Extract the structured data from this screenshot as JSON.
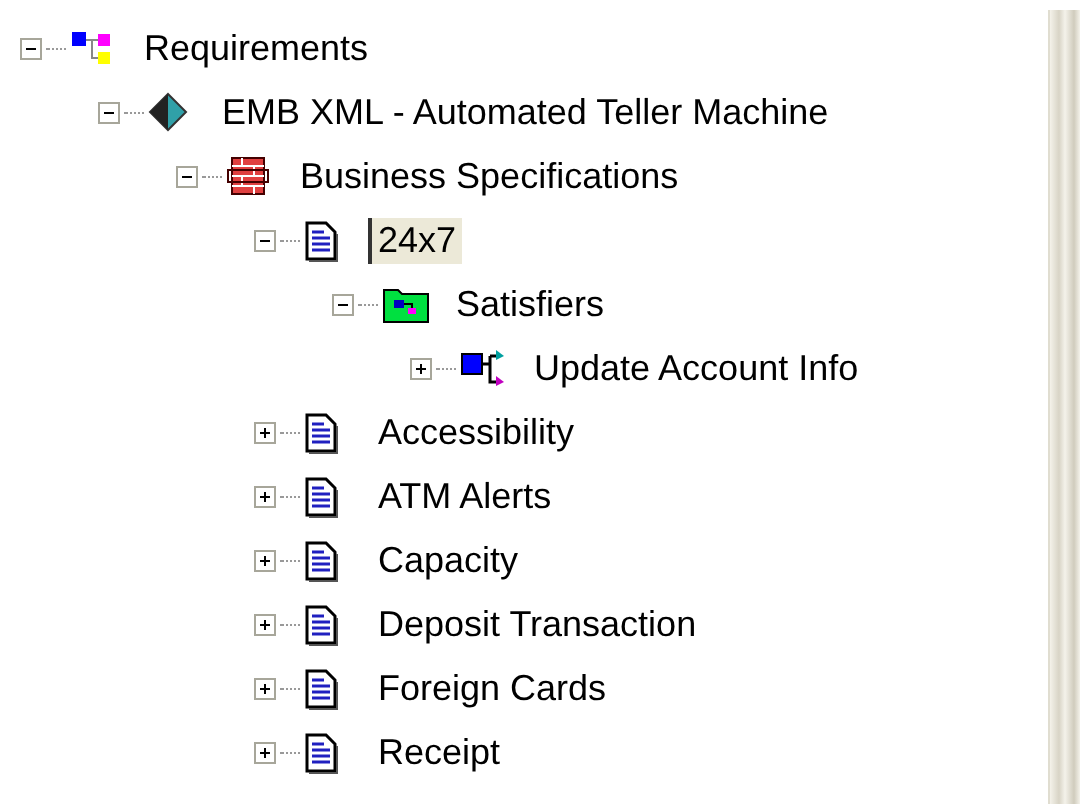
{
  "tree": [
    {
      "label": "Requirements",
      "kind": "requirements",
      "expanded": true,
      "selected": false,
      "children": [
        {
          "label": "EMB XML - Automated Teller Machine",
          "kind": "package",
          "expanded": true,
          "selected": false,
          "children": [
            {
              "label": "Business Specifications",
              "kind": "bricks",
              "expanded": true,
              "selected": false,
              "children": [
                {
                  "label": "24x7",
                  "kind": "document",
                  "expanded": true,
                  "selected": true,
                  "children": [
                    {
                      "label": "Satisfiers",
                      "kind": "folder",
                      "expanded": true,
                      "selected": false,
                      "children": [
                        {
                          "label": "Update Account Info",
                          "kind": "link",
                          "expanded": false,
                          "selected": false
                        }
                      ]
                    }
                  ]
                },
                {
                  "label": "Accessibility",
                  "kind": "document",
                  "expanded": false,
                  "selected": false
                },
                {
                  "label": "ATM Alerts",
                  "kind": "document",
                  "expanded": false,
                  "selected": false
                },
                {
                  "label": "Capacity",
                  "kind": "document",
                  "expanded": false,
                  "selected": false
                },
                {
                  "label": "Deposit Transaction",
                  "kind": "document",
                  "expanded": false,
                  "selected": false
                },
                {
                  "label": "Foreign Cards",
                  "kind": "document",
                  "expanded": false,
                  "selected": false
                },
                {
                  "label": "Receipt",
                  "kind": "document",
                  "expanded": false,
                  "selected": false
                }
              ]
            }
          ]
        }
      ]
    }
  ]
}
